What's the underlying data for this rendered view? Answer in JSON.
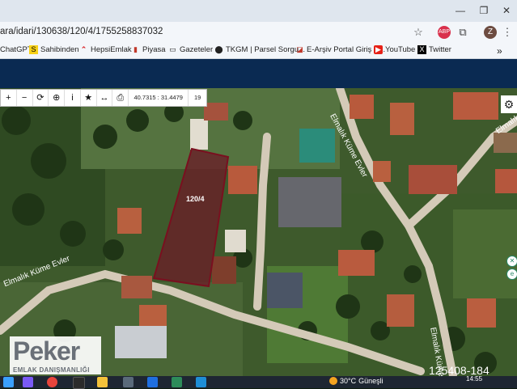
{
  "browser": {
    "url": "ara/idari/130638/120/4/1755258837032",
    "profile_initial": "Z",
    "extension_badge": "ABP",
    "window_controls": [
      "—",
      "❐",
      "✕"
    ]
  },
  "bookmarks": [
    {
      "label": "ChatGPT",
      "icon": "chatgpt-icon"
    },
    {
      "label": "Sahibinden",
      "icon": "sahibinden-icon"
    },
    {
      "label": "HepsiEmlak",
      "icon": "hepsiemlak-icon"
    },
    {
      "label": "Piyasa",
      "icon": "piyasa-icon"
    },
    {
      "label": "Gazeteler",
      "icon": "folder-icon"
    },
    {
      "label": "TKGM | Parsel Sorgu...",
      "icon": "location-pin-icon"
    },
    {
      "label": "E-Arşiv Portal Giriş E...",
      "icon": "earsiv-icon"
    },
    {
      "label": "YouTube",
      "icon": "youtube-icon"
    },
    {
      "label": "Twitter",
      "icon": "twitter-icon"
    }
  ],
  "map_toolbar": {
    "tools": [
      "+",
      "−",
      "⟳",
      "⊕",
      "i",
      "★",
      "↔",
      "⎙"
    ],
    "coordinates": "40.7315 : 31.4479",
    "zoom": "19"
  },
  "map": {
    "parcel_label": "120/4",
    "road_labels": [
      "Elmalık Küme Evler",
      "Elmalık Küme Evler",
      "Elmalık Küme Evler",
      "Elmalık Küme"
    ],
    "colors": {
      "parcel_fill": "#6a1e28",
      "parcel_stroke": "#7a0f1f",
      "road": "#d8d0c0"
    }
  },
  "watermark": {
    "name": "Peker",
    "subtitle": "EMLAK DANIŞMANLIĞI"
  },
  "listing_id": "125408-184",
  "taskbar": {
    "weather_temp": "30°C",
    "weather_text": "Güneşli",
    "time": "14:55"
  }
}
